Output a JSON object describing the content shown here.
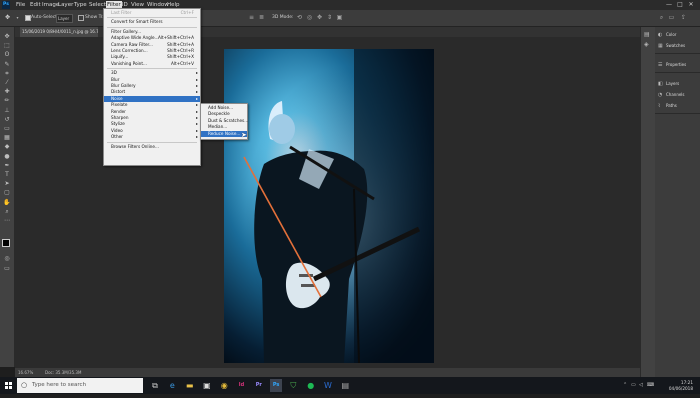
{
  "menubar": {
    "items": [
      "File",
      "Edit",
      "Image",
      "Layer",
      "Type",
      "Select",
      "Filter",
      "3D",
      "View",
      "Window",
      "Help"
    ],
    "active": "Filter",
    "controls": [
      "—",
      "□",
      "✕"
    ]
  },
  "options_bar": {
    "auto_select_label": "Auto-Select:",
    "auto_select_value": "Layer",
    "show_transform_label": "Show Tra",
    "mode_3d_label": "3D Mode:"
  },
  "document": {
    "tab_title": "15/06/2019 0/8H/4/0011_n.jpg @ 16.7% (RGB/8)"
  },
  "statusbar": {
    "zoom": "16.67%",
    "doc_info": "Doc: 35.3M/35.3M"
  },
  "filter_menu": {
    "items": [
      {
        "label": "Last Filter",
        "shortcut": "Ctrl+F",
        "disabled": true
      },
      {
        "separator": true
      },
      {
        "label": "Convert for Smart Filters"
      },
      {
        "separator": true
      },
      {
        "label": "Filter Gallery..."
      },
      {
        "label": "Adaptive Wide Angle...",
        "shortcut": "Alt+Shift+Ctrl+A"
      },
      {
        "label": "Camera Raw Filter...",
        "shortcut": "Shift+Ctrl+A"
      },
      {
        "label": "Lens Correction...",
        "shortcut": "Shift+Ctrl+R"
      },
      {
        "label": "Liquify...",
        "shortcut": "Shift+Ctrl+X"
      },
      {
        "label": "Vanishing Point...",
        "shortcut": "Alt+Ctrl+V"
      },
      {
        "separator": true
      },
      {
        "label": "3D",
        "submenu": true
      },
      {
        "label": "Blur",
        "submenu": true
      },
      {
        "label": "Blur Gallery",
        "submenu": true
      },
      {
        "label": "Distort",
        "submenu": true
      },
      {
        "label": "Noise",
        "submenu": true,
        "highlighted": true
      },
      {
        "label": "Pixelate",
        "submenu": true
      },
      {
        "label": "Render",
        "submenu": true
      },
      {
        "label": "Sharpen",
        "submenu": true
      },
      {
        "label": "Stylize",
        "submenu": true
      },
      {
        "label": "Video",
        "submenu": true
      },
      {
        "label": "Other",
        "submenu": true
      },
      {
        "separator": true
      },
      {
        "label": "Browse Filters Online..."
      }
    ]
  },
  "noise_submenu": {
    "items": [
      {
        "label": "Add Noise..."
      },
      {
        "label": "Despeckle"
      },
      {
        "label": "Dust & Scratches..."
      },
      {
        "label": "Median..."
      },
      {
        "label": "Reduce Noise...",
        "highlighted": true
      }
    ]
  },
  "panels": {
    "groups": [
      [
        "Color",
        "Swatches"
      ],
      [
        "Properties"
      ],
      [
        "Layers",
        "Channels",
        "Paths"
      ]
    ]
  },
  "taskbar": {
    "search_placeholder": "Type here to search",
    "time": "17:21",
    "date": "04/06/2018",
    "apps": [
      {
        "name": "task-view",
        "glyph": "⧉",
        "color": "#cccccc"
      },
      {
        "name": "edge",
        "glyph": "e",
        "color": "#3a96dd"
      },
      {
        "name": "file-explorer",
        "glyph": "▬",
        "color": "#e8c14a"
      },
      {
        "name": "store",
        "glyph": "▣",
        "color": "#dddddd"
      },
      {
        "name": "chrome",
        "glyph": "◉",
        "color": "#e0b83a"
      },
      {
        "name": "indesign",
        "glyph": "Id",
        "color": "#d6337a"
      },
      {
        "name": "premiere",
        "glyph": "Pr",
        "color": "#9b8cff"
      },
      {
        "name": "photoshop",
        "glyph": "Ps",
        "color": "#31a8ff",
        "active": true
      },
      {
        "name": "shield",
        "glyph": "⛉",
        "color": "#4caf50"
      },
      {
        "name": "spotify",
        "glyph": "●",
        "color": "#1db954"
      },
      {
        "name": "word",
        "glyph": "W",
        "color": "#2b6cd1"
      },
      {
        "name": "notepad",
        "glyph": "▤",
        "color": "#aaaaaa"
      }
    ]
  }
}
